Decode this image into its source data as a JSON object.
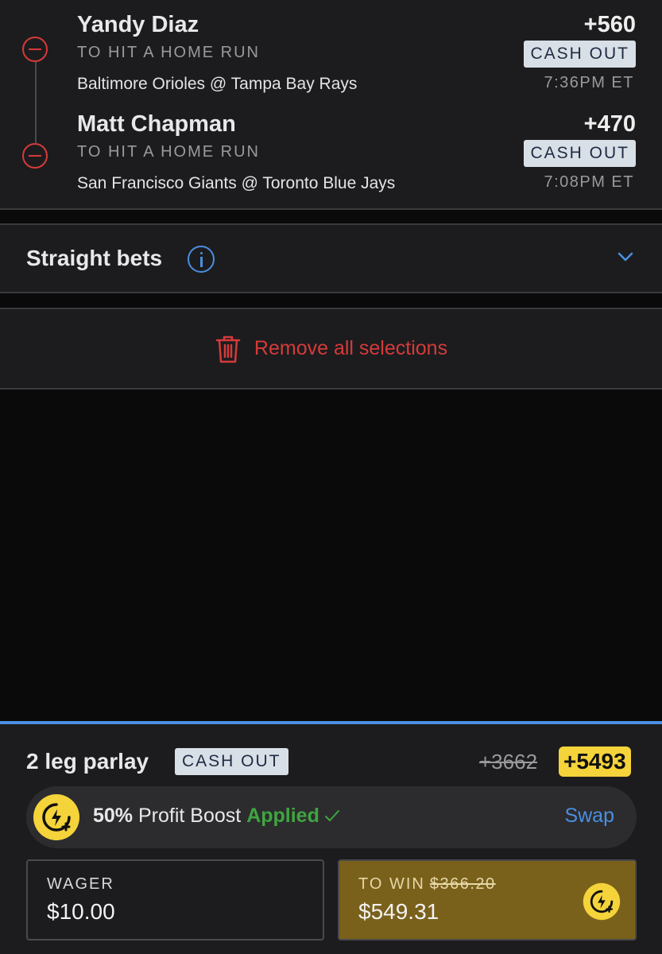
{
  "legs": [
    {
      "player": "Yandy Diaz",
      "market": "TO HIT A HOME RUN",
      "game": "Baltimore Orioles @ Tampa Bay Rays",
      "odds": "+560",
      "cashout_label": "CASH OUT",
      "time": "7:36PM ET"
    },
    {
      "player": "Matt Chapman",
      "market": "TO HIT A HOME RUN",
      "game": "San Francisco Giants @ Toronto Blue Jays",
      "odds": "+470",
      "cashout_label": "CASH OUT",
      "time": "7:08PM ET"
    }
  ],
  "straight_bets": {
    "label": "Straight bets",
    "icon": "info-icon",
    "toggle_icon": "chevron-down-icon"
  },
  "remove_all": {
    "label": "Remove all selections",
    "icon": "trash-icon"
  },
  "slip": {
    "title": "2 leg parlay",
    "cashout_label": "CASH OUT",
    "original_odds": "+3662",
    "boosted_odds": "+5493",
    "boost": {
      "percent": "50%",
      "text": "Profit Boost",
      "status": "Applied",
      "swap_label": "Swap",
      "icon": "profit-boost-icon"
    },
    "wager": {
      "label": "WAGER",
      "value": "$10.00"
    },
    "to_win": {
      "label": "TO WIN",
      "original_value": "$366.20",
      "value": "$549.31",
      "icon": "profit-boost-icon"
    }
  },
  "colors": {
    "accent_blue": "#4a8fe0",
    "remove_red": "#d63a3a",
    "boost_yellow": "#f5d33a",
    "applied_green": "#3fa540",
    "to_win_bg": "#7a611b"
  }
}
